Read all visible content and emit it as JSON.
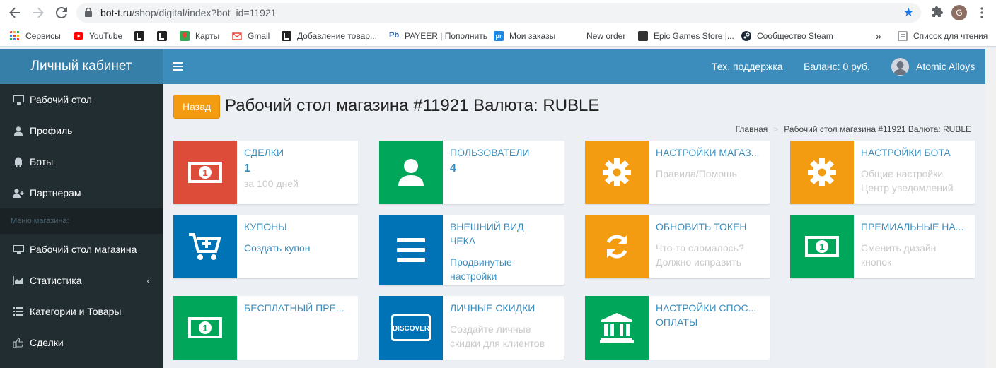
{
  "browser": {
    "url_host": "bot-t.ru",
    "url_path": "/shop/digital/index?bot_id=11921",
    "profile_initial": "G"
  },
  "bookmarks": [
    {
      "label": "Сервисы"
    },
    {
      "label": "YouTube"
    },
    {
      "label": ""
    },
    {
      "label": ""
    },
    {
      "label": "Карты"
    },
    {
      "label": "Gmail"
    },
    {
      "label": "Добавление товар..."
    },
    {
      "label": "PAYEER | Пополнить"
    },
    {
      "label": "Мои заказы"
    },
    {
      "label": "New order"
    },
    {
      "label": "Epic Games Store |..."
    },
    {
      "label": "Сообщество Steam"
    },
    {
      "label": "»"
    },
    {
      "label": "Список для чтения"
    }
  ],
  "sidebar": {
    "logo": "Личный кабинет",
    "items": [
      {
        "label": "Рабочий стол",
        "icon": "desktop-icon"
      },
      {
        "label": "Профиль",
        "icon": "user-icon"
      },
      {
        "label": "Боты",
        "icon": "android-icon"
      },
      {
        "label": "Партнерам",
        "icon": "user-plus-icon"
      }
    ],
    "shop_header": "Меню магазина:",
    "shop_items": [
      {
        "label": "Рабочий стол магазина",
        "icon": "desktop-icon"
      },
      {
        "label": "Статистика",
        "icon": "chart-icon"
      },
      {
        "label": "Категории и Товары",
        "icon": "list-icon"
      },
      {
        "label": "Сделки",
        "icon": "thumbs-up-icon"
      }
    ]
  },
  "topbar": {
    "support": "Тех. поддержка",
    "balance": "Баланс: 0 руб.",
    "user": "Atomic Alloys"
  },
  "content": {
    "back": "Назад",
    "title": "Рабочий стол магазина #11921 Валюта: RUBLE",
    "breadcrumb_home": "Главная",
    "breadcrumb_current": "Рабочий стол магазина #11921 Валюта: RUBLE"
  },
  "boxes": [
    {
      "title": "СДЕЛКИ",
      "number": "1",
      "sub1": "за 100 дней",
      "color": "#dd4b39",
      "icon": "money-icon"
    },
    {
      "title": "ПОЛЬЗОВАТЕЛИ",
      "number": "4",
      "color": "#00a65a",
      "icon": "user-icon"
    },
    {
      "title": "НАСТРОЙКИ МАГАЗ...",
      "sub1": "Правила/Помощь",
      "color": "#f39c12",
      "icon": "gear-icon"
    },
    {
      "title": "НАСТРОЙКИ БОТА",
      "sub1": "Общие настройки",
      "sub2": "Центр уведомлений",
      "color": "#f39c12",
      "icon": "gear-icon"
    },
    {
      "title": "КУПОНЫ",
      "sub1": "Создать купон",
      "color": "#0073b7",
      "icon": "cart-plus-icon"
    },
    {
      "title": "ВНЕШНИЙ ВИД ЧЕКА",
      "sub1": "Продвинутые",
      "sub2": "настройки",
      "color": "#0073b7",
      "icon": "list-icon"
    },
    {
      "title": "ОБНОВИТЬ ТОКЕН",
      "sub1": "Что-то сломалось?",
      "sub2": "Должно исправить",
      "color": "#f39c12",
      "icon": "refresh-icon"
    },
    {
      "title": "ПРЕМИАЛЬНЫЕ НА...",
      "sub1": "Сменить дизайн",
      "sub2": "кнопок",
      "color": "#00a65a",
      "icon": "money-icon"
    },
    {
      "title": "БЕСПЛАТНЫЙ ПРЕ...",
      "color": "#00a65a",
      "icon": "money-icon"
    },
    {
      "title": "ЛИЧНЫЕ СКИДКИ",
      "sub1": "Создайте личные",
      "sub2": "скидки для клиентов",
      "color": "#0073b7",
      "icon": "discover-card-icon",
      "icon_text": "DISCOVER"
    },
    {
      "title": "НАСТРОЙКИ СПОС...",
      "title2": "ОПЛАТЫ",
      "color": "#00a65a",
      "icon": "bank-icon"
    }
  ]
}
